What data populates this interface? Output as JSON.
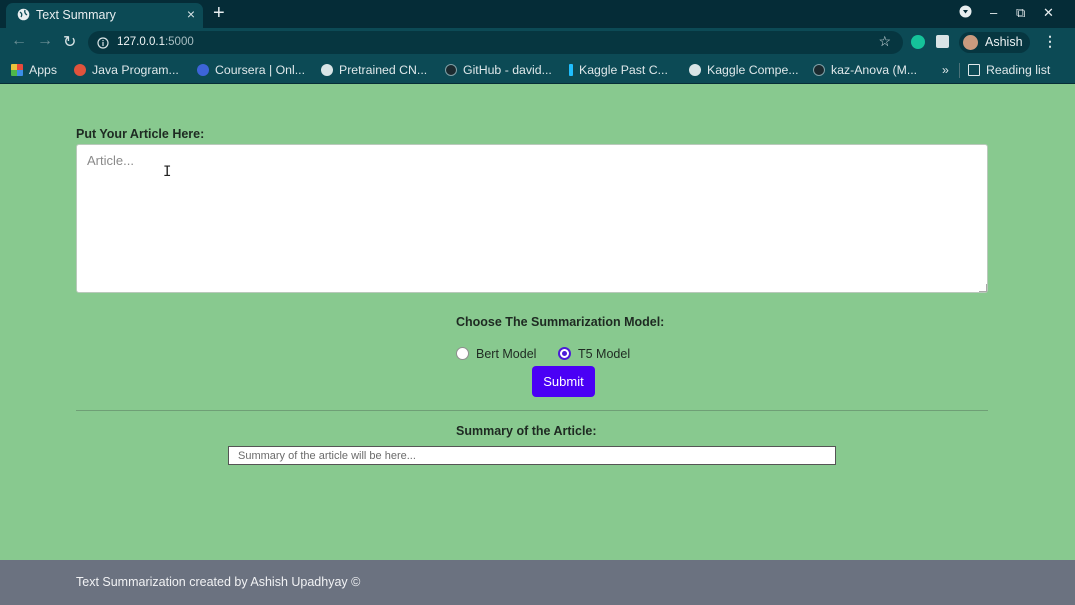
{
  "browser": {
    "tab": {
      "title": "Text Summary",
      "close": "×"
    },
    "new_tab": "+",
    "window_controls": {
      "minimize": "–",
      "restore": "⧉",
      "close": "✕"
    },
    "nav": {
      "back": "←",
      "forward": "→",
      "reload": "↻"
    },
    "address": {
      "host": "127.0.0.1",
      "port": ":5000",
      "star": "☆"
    },
    "profile": {
      "name": "Ashish"
    },
    "menu": "⋮",
    "bookmarks": [
      {
        "label": "Apps",
        "icon": "apps-grid-icon",
        "color": "#e8a33c"
      },
      {
        "label": "Java Program...",
        "icon": "java-icon",
        "color": "#e0533c"
      },
      {
        "label": "Coursera | Onl...",
        "icon": "coursera-icon",
        "color": "#3d64d8"
      },
      {
        "label": "Pretrained CN...",
        "icon": "globe-icon",
        "color": "#d9e4e6"
      },
      {
        "label": "GitHub - david...",
        "icon": "github-icon",
        "color": "#1b2a2f"
      },
      {
        "label": "Kaggle Past C...",
        "icon": "kaggle-icon",
        "color": "#20beff"
      },
      {
        "label": "Kaggle Compe...",
        "icon": "globe-icon",
        "color": "#d9e4e6"
      },
      {
        "label": "kaz-Anova (M...",
        "icon": "github-icon",
        "color": "#1b2a2f"
      }
    ],
    "bookmarks_overflow": "»",
    "reading_list": "Reading list"
  },
  "form": {
    "article_label": "Put Your Article Here:",
    "article_placeholder": "Article...",
    "article_value": "",
    "model_label": "Choose The Summarization Model:",
    "models": [
      {
        "label": "Bert Model",
        "checked": false
      },
      {
        "label": "T5 Model",
        "checked": true
      }
    ],
    "submit_label": "Submit"
  },
  "summary": {
    "label": "Summary of the Article:",
    "placeholder": "Summary of the article will be here..."
  },
  "footer": {
    "text": "Text Summarization created by Ashish Upadhyay ©"
  },
  "colors": {
    "page_bg": "#88c98f",
    "accent": "#4a00f5",
    "footer_bg": "#6b7280",
    "chrome_dark": "#052c37",
    "chrome": "#0c4a55"
  }
}
